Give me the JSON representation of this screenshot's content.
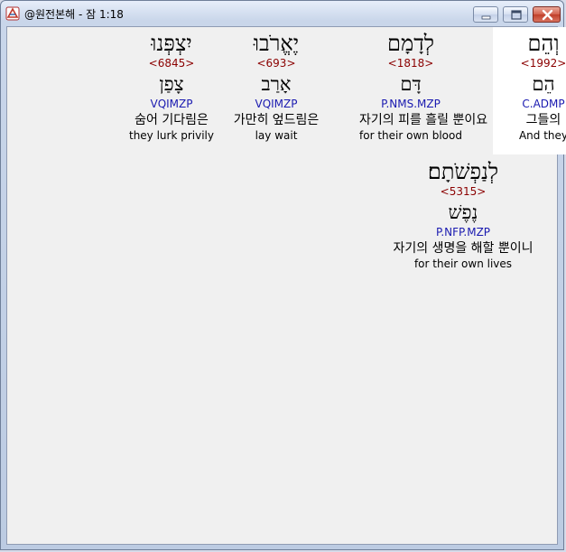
{
  "window": {
    "title": "@원전본해 - 잠 1:18"
  },
  "words": [
    {
      "hebrew": "וְהֵם",
      "strong": "<1992>",
      "root": "הֵם",
      "parsing": "C.ADMP",
      "korean": "그들의",
      "english": "And they"
    },
    {
      "hebrew": "לְדָמָם",
      "strong": "<1818>",
      "root": "דָּם",
      "parsing": "P.NMS.MZP",
      "korean": "자기의 피를 흘릴 뿐이요",
      "english": "for their own blood"
    },
    {
      "hebrew": "יֶאֱרֹבוּ",
      "strong": "<693>",
      "root": "אָרַב",
      "parsing": "VQIMZP",
      "korean": "가만히 엎드림은",
      "english": "lay wait"
    },
    {
      "hebrew": "יִצְפְּנוּ",
      "strong": "<6845>",
      "root": "צָפַן",
      "parsing": "VQIMZP",
      "korean": "숨어 기다림은",
      "english": "they lurk privily"
    },
    {
      "hebrew": "לְנַפְשֹׁתָם׃",
      "strong": "<5315>",
      "root": "נֶפֶשׁ",
      "parsing": "P.NFP.MZP",
      "korean": "자기의 생명을 해할 뿐이니",
      "english": "for their own lives"
    }
  ]
}
